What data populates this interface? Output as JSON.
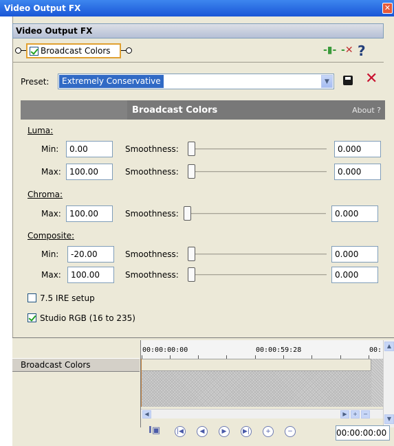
{
  "window": {
    "title": "Video Output FX",
    "close_glyph": "✕"
  },
  "header": {
    "title": "Video Output FX"
  },
  "chain": {
    "plugin_label": "Broadcast Colors",
    "plugin_checked": true,
    "icons": [
      "plugin-chooser-icon",
      "remove-plugin-icon",
      "help-icon"
    ],
    "help_glyph": "?"
  },
  "preset": {
    "label": "Preset:",
    "value": "Extremely Conservative",
    "dropdown_glyph": "▼",
    "delete_glyph": "✕"
  },
  "plugin": {
    "name": "Broadcast Colors",
    "about": "About  ?"
  },
  "luma": {
    "group": "Luma:",
    "min_label": "Min:",
    "min_value": "0.00",
    "max_label": "Max:",
    "max_value": "100.00",
    "min_smooth_label": "Smoothness:",
    "min_smooth_value": "0.000",
    "min_smooth_level": 0,
    "max_smooth_label": "Smoothness:",
    "max_smooth_value": "0.000",
    "max_smooth_level": 0
  },
  "chroma": {
    "group": "Chroma:",
    "max_label": "Max:",
    "max_value": "100.00",
    "smooth_label": "Smoothness:",
    "smooth_value": "0.000",
    "smooth_level": 0
  },
  "composite": {
    "group": "Composite:",
    "min_label": "Min:",
    "min_value": "-20.00",
    "max_label": "Max:",
    "max_value": "100.00",
    "min_smooth_label": "Smoothness:",
    "min_smooth_value": "0.000",
    "min_smooth_level": 0,
    "max_smooth_label": "Smoothness:",
    "max_smooth_value": "0.000",
    "max_smooth_level": 0
  },
  "options": {
    "ire_label": "7.5 IRE setup",
    "ire_checked": false,
    "studio_label": "Studio RGB (16 to 235)",
    "studio_checked": true
  },
  "tracks": {
    "items": [
      {
        "label": "Broadcast Colors"
      }
    ]
  },
  "timeline": {
    "labels": [
      "00:00:00:00",
      "00:00:59:28",
      "00:"
    ],
    "timecode": "00:00:00:00"
  },
  "colors": {
    "title_bar": "#1a56d6",
    "selection": "#316ac5",
    "delete": "#c8102e",
    "plugin_bar": "#787878"
  }
}
